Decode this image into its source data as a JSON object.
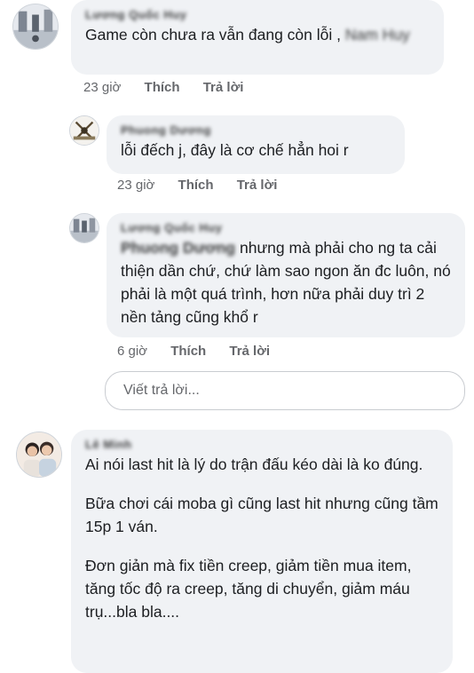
{
  "comments": [
    {
      "author": "Lương Quốc Huy",
      "text": "Game còn chưa ra vẫn đang còn lỗi ,",
      "text_tail": "Nam Huy",
      "time": "23 giờ",
      "like": "Thích",
      "reply": "Trả lời"
    },
    {
      "author": "Phuong Dương",
      "text": "lỗi đếch j, đây là cơ chế hẳn hoi r",
      "time": "23 giờ",
      "like": "Thích",
      "reply": "Trả lời"
    },
    {
      "author": "Lương Quốc Huy",
      "mention": "Phuong Dương",
      "text": " nhưng mà phải cho ng ta cải thiện dần chứ, chứ làm sao ngon ăn đc luôn, nó phải là một quá trình, hơn nữa phải duy trì 2 nền tảng cũng khổ r",
      "time": "6 giờ",
      "like": "Thích",
      "reply": "Trả lời"
    },
    {
      "author": "Lê Minh",
      "paragraphs": [
        "Ai nói last hit là lý do trận đấu kéo dài là ko đúng.",
        "Bữa chơi cái moba gì cũng last hit nhưng cũng tầm 15p 1 ván.",
        "Đơn giản mà fix tiền creep, giảm tiền mua item, tăng tốc độ ra creep, tăng di chuyển, giảm máu trụ...bla bla...."
      ]
    }
  ],
  "reply_input": {
    "placeholder": "Viết trả lời..."
  },
  "icons": {
    "avatar_1": "avatar-image",
    "avatar_2": "avatar-crossed-swords",
    "avatar_3": "avatar-image",
    "avatar_4": "avatar-couple-photo"
  }
}
